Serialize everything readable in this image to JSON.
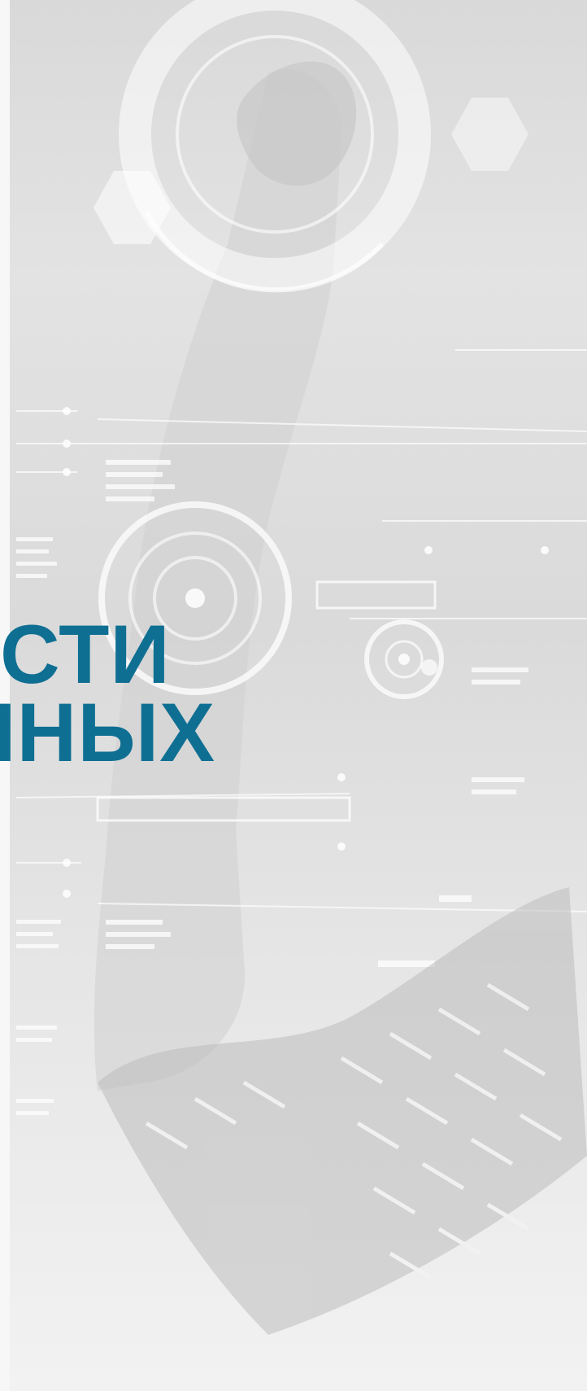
{
  "hero": {
    "headline_line1": "СТИ",
    "headline_line2": "ННЫХ"
  },
  "colors": {
    "headline": "#0f6f93",
    "background": "#e0e0e0"
  }
}
